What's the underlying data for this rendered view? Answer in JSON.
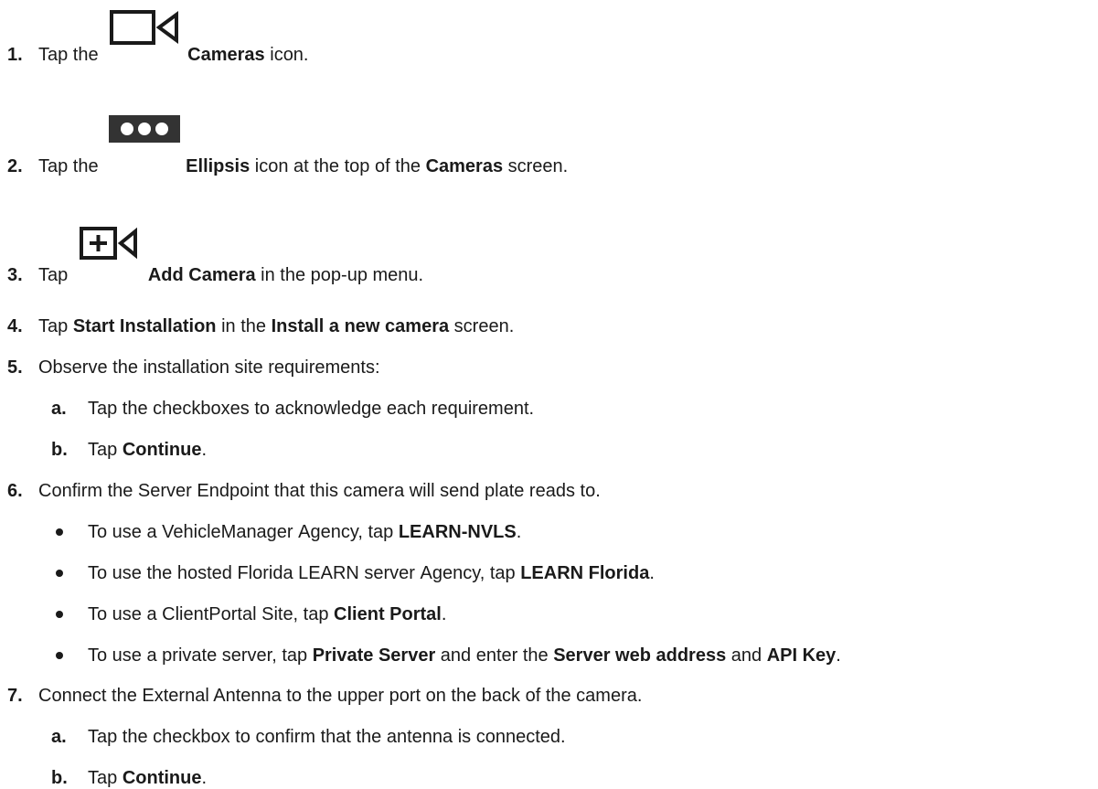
{
  "steps": [
    {
      "num": "1.",
      "parts": [
        {
          "t": "Tap the "
        },
        {
          "t": "Cameras",
          "b": true
        },
        {
          "t": " icon."
        }
      ],
      "icon": "video-camera-icon"
    },
    {
      "num": "2.",
      "parts": [
        {
          "t": "Tap the "
        },
        {
          "t": "Ellipsis",
          "b": true
        },
        {
          "t": " icon at the top of the "
        },
        {
          "t": "Cameras",
          "b": true
        },
        {
          "t": " screen."
        }
      ],
      "icon": "ellipsis-icon"
    },
    {
      "num": "3.",
      "parts": [
        {
          "t": "Tap "
        },
        {
          "t": "Add Camera",
          "b": true
        },
        {
          "t": " in the pop-up menu."
        }
      ],
      "icon": "add-camera-icon"
    },
    {
      "num": "4.",
      "parts": [
        {
          "t": "Tap "
        },
        {
          "t": "Start Installation",
          "b": true
        },
        {
          "t": " in the "
        },
        {
          "t": "Install a new camera",
          "b": true
        },
        {
          "t": " screen."
        }
      ]
    },
    {
      "num": "5.",
      "parts": [
        {
          "t": "Observe the installation site requirements:"
        }
      ],
      "sub": [
        {
          "num": "a.",
          "parts": [
            {
              "t": "Tap the checkboxes to acknowledge each requirement."
            }
          ]
        },
        {
          "num": "b.",
          "parts": [
            {
              "t": "Tap "
            },
            {
              "t": "Continue",
              "b": true
            },
            {
              "t": "."
            }
          ]
        }
      ]
    },
    {
      "num": "6.",
      "parts": [
        {
          "t": "Confirm the Server Endpoint that this camera will send plate reads to."
        }
      ],
      "bullets": [
        [
          {
            "t": "To use a VehicleManager Agency, tap "
          },
          {
            "t": "LEARN-NVLS",
            "b": true
          },
          {
            "t": "."
          }
        ],
        [
          {
            "t": "To use the hosted Florida LEARN server Agency, tap "
          },
          {
            "t": "LEARN Florida",
            "b": true
          },
          {
            "t": "."
          }
        ],
        [
          {
            "t": "To use a ClientPortal Site, tap "
          },
          {
            "t": "Client Portal",
            "b": true
          },
          {
            "t": "."
          }
        ],
        [
          {
            "t": "To use a private server, tap "
          },
          {
            "t": "Private Server",
            "b": true
          },
          {
            "t": " and enter the "
          },
          {
            "t": "Server web address",
            "b": true
          },
          {
            "t": " and "
          },
          {
            "t": "API Key",
            "b": true
          },
          {
            "t": "."
          }
        ]
      ]
    },
    {
      "num": "7.",
      "parts": [
        {
          "t": "Connect the External Antenna to the upper port on the back of the camera."
        }
      ],
      "sub": [
        {
          "num": "a.",
          "parts": [
            {
              "t": "Tap the checkbox to confirm that the antenna is connected."
            }
          ]
        },
        {
          "num": "b.",
          "parts": [
            {
              "t": "Tap "
            },
            {
              "t": "Continue",
              "b": true
            },
            {
              "t": "."
            }
          ]
        }
      ]
    }
  ]
}
